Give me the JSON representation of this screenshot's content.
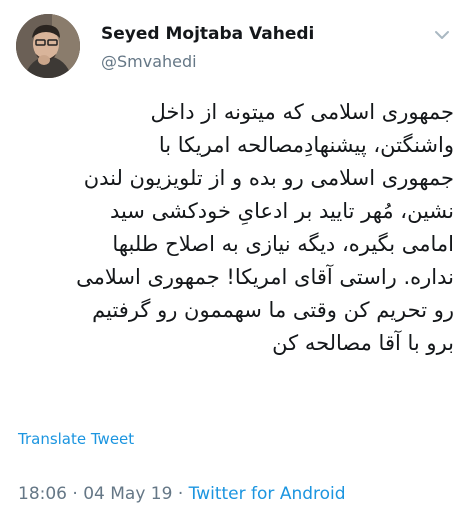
{
  "user": {
    "name": "Seyed Mojtaba Vahedi",
    "handle": "@Smvahedi"
  },
  "tweet": {
    "text": "جمهوری اسلامی که میتونه از داخل\nواشنگتن، پیشنهادِمصالحه امریکا با\nجمهوری اسلامی رو بده و از تلویزیون لندن\nنشین، مُهر تایید بر ادعایِ خودکشی سید\nامامی بگیره، دیگه نیازی به اصلاح طلبها\nنداره. راستی آقای امریکا! جمهوری اسلامی\nرو تحریم کن وقتی ما سهممون رو گرفتیم\nبرو با آقا مصالحه کن",
    "translate_label": "Translate Tweet",
    "time": "18:06",
    "date": "04 May 19",
    "source": "Twitter for Android"
  },
  "icons": {
    "menu": "chevron-down-icon"
  },
  "colors": {
    "link": "#1b95e0",
    "secondary": "#657786",
    "text": "#14171a"
  }
}
